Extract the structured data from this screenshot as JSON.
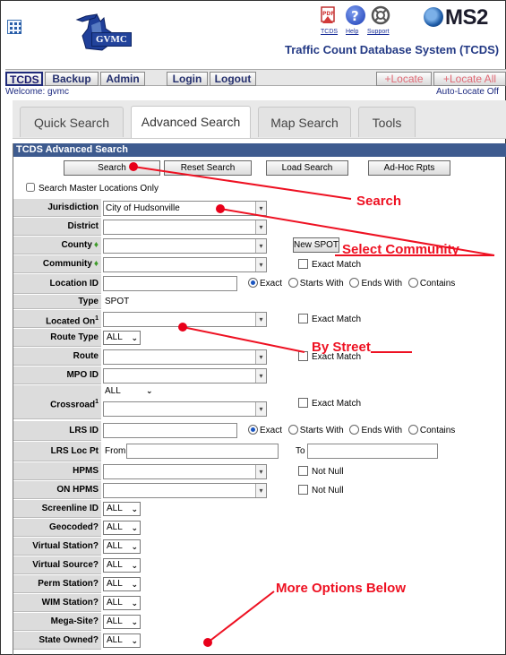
{
  "header": {
    "logo_text": "GVMC",
    "icons": [
      {
        "name": "tcds-icon",
        "label": "TCDS",
        "color": "#d23a3a"
      },
      {
        "name": "help-icon",
        "label": "Help",
        "color": "#2e4fb0"
      },
      {
        "name": "support-icon",
        "label": "Support",
        "color": "#666666"
      }
    ],
    "brand": "MS2",
    "app_title": "Traffic Count Database System (TCDS)"
  },
  "toolbar": {
    "buttons": [
      "TCDS",
      "Backup",
      "Admin",
      "Login",
      "Logout"
    ],
    "locate": "Locate",
    "locate_all": "Locate All"
  },
  "welcome": "Welcome: gvmc",
  "autolocate": "Auto-Locate Off",
  "tabs": [
    "Quick Search",
    "Advanced Search",
    "Map Search",
    "Tools"
  ],
  "panel": {
    "title": "TCDS Advanced Search",
    "buttons": [
      "Search",
      "Reset Search",
      "Load Search",
      "Ad-Hoc Rpts"
    ],
    "master_only": "Search Master Locations Only"
  },
  "fields": {
    "jurisdiction": {
      "label": "Jurisdiction",
      "value": "City of Hudsonville"
    },
    "district": {
      "label": "District",
      "value": ""
    },
    "county": {
      "label": "County",
      "value": "",
      "new_spot": "New SPOT"
    },
    "community": {
      "label": "Community",
      "value": "",
      "exact": "Exact Match"
    },
    "location_id": {
      "label": "Location ID",
      "value": ""
    },
    "type": {
      "label": "Type",
      "value": "SPOT"
    },
    "located_on": {
      "label": "Located On",
      "value": "",
      "exact": "Exact Match"
    },
    "route_type": {
      "label": "Route Type",
      "value": "ALL"
    },
    "route": {
      "label": "Route",
      "value": "",
      "exact": "Exact Match"
    },
    "mpo_id": {
      "label": "MPO ID",
      "value": ""
    },
    "crossroad": {
      "label": "Crossroad",
      "value": "ALL",
      "exact": "Exact Match"
    },
    "lrs_id": {
      "label": "LRS ID",
      "value": ""
    },
    "lrs_loc_pt": {
      "label": "LRS Loc Pt",
      "from": "From",
      "to": "To"
    },
    "hpms": {
      "label": "HPMS",
      "value": "",
      "not_null": "Not Null"
    },
    "on_hpms": {
      "label": "ON HPMS",
      "value": "",
      "not_null": "Not Null"
    }
  },
  "match_modes": [
    "Exact",
    "Starts With",
    "Ends With",
    "Contains"
  ],
  "yes_no_fields": [
    {
      "label": "Screenline ID",
      "value": "ALL"
    },
    {
      "label": "Geocoded?",
      "value": "ALL"
    },
    {
      "label": "Virtual Station?",
      "value": "ALL"
    },
    {
      "label": "Virtual Source?",
      "value": "ALL"
    },
    {
      "label": "Perm Station?",
      "value": "ALL"
    },
    {
      "label": "WIM Station?",
      "value": "ALL"
    },
    {
      "label": "Mega-Site?",
      "value": "ALL"
    },
    {
      "label": "State Owned?",
      "value": "ALL"
    }
  ],
  "annotations": {
    "search": "Search",
    "select_community": "Select Community",
    "by_street": "By Street",
    "more_options": "More Options Below",
    "color": "#ee1122"
  }
}
